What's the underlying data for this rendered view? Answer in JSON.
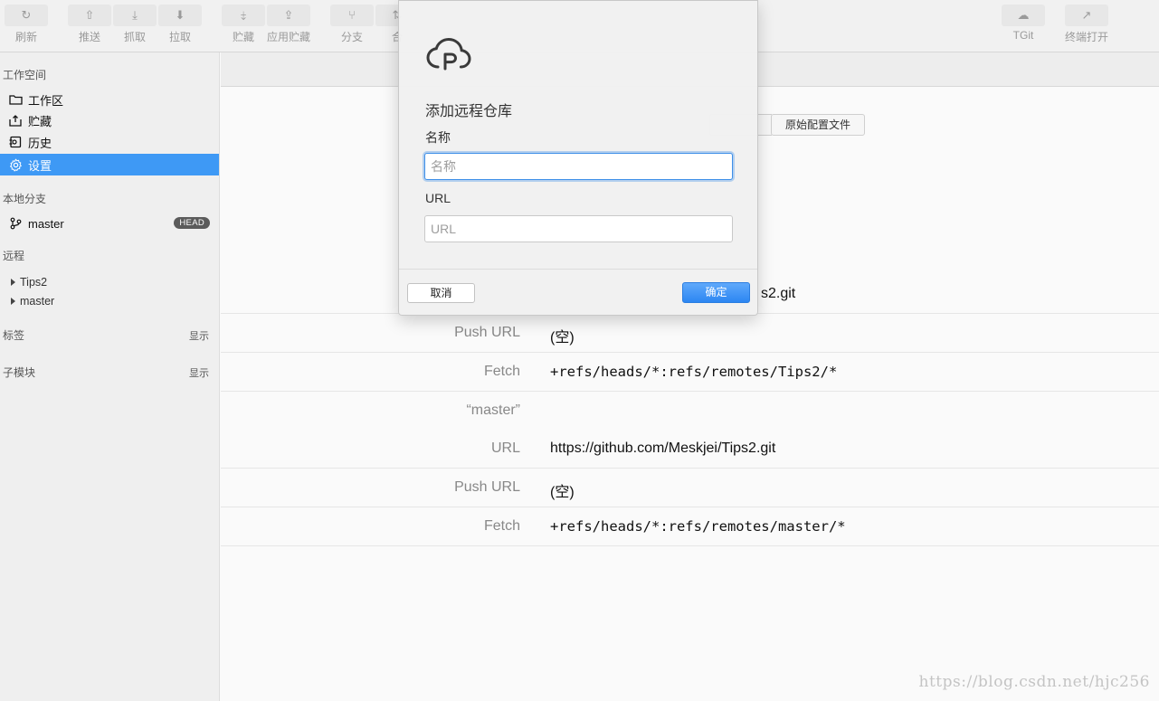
{
  "toolbar": {
    "buttons": [
      {
        "label": "刷新",
        "icon": "↻"
      },
      {
        "label": "推送",
        "icon": "⇧"
      },
      {
        "label": "抓取",
        "icon": "⤓"
      },
      {
        "label": "拉取",
        "icon": "⬇"
      },
      {
        "label": "贮藏",
        "icon": "⤈"
      },
      {
        "label": "应用贮藏",
        "icon": "⇪"
      },
      {
        "label": "分支",
        "icon": "⑂"
      },
      {
        "label": "合",
        "icon": "⇅"
      },
      {
        "label": "TGit",
        "icon": "☁"
      },
      {
        "label": "终端打开",
        "icon": "↗"
      }
    ]
  },
  "sidebar": {
    "workspace_title": "工作空间",
    "workspace_items": [
      {
        "label": "工作区",
        "icon": "folder-icon"
      },
      {
        "label": "贮藏",
        "icon": "stash-icon"
      },
      {
        "label": "历史",
        "icon": "history-icon"
      },
      {
        "label": "设置",
        "icon": "gear-icon",
        "active": true
      }
    ],
    "local_branch_title": "本地分支",
    "local_branch": {
      "label": "master",
      "badge": "HEAD"
    },
    "remote_title": "远程",
    "remotes": [
      "Tips2",
      "master"
    ],
    "tags_title": "标签",
    "tags_action": "显示",
    "submodules_title": "子模块",
    "submodules_action": "显示"
  },
  "content": {
    "config_button": "原始配置文件",
    "rows": [
      {
        "label": "",
        "value": "s2.git",
        "mono": false
      },
      {
        "label": "Push URL",
        "value": "(空)",
        "mono": false
      },
      {
        "label": "Fetch",
        "value": "+refs/heads/*:refs/remotes/Tips2/*",
        "mono": true
      },
      {
        "label": "“master”",
        "value": "",
        "mono": false
      },
      {
        "label": "URL",
        "value": "https://github.com/Meskjei/Tips2.git",
        "mono": false
      },
      {
        "label": "Push URL",
        "value": "(空)",
        "mono": false
      },
      {
        "label": "Fetch",
        "value": "+refs/heads/*:refs/remotes/master/*",
        "mono": true
      }
    ]
  },
  "dialog": {
    "title": "添加远程仓库",
    "name_label": "名称",
    "name_placeholder": "名称",
    "name_value": "",
    "url_label": "URL",
    "url_placeholder": "URL",
    "url_value": "",
    "cancel_label": "取消",
    "ok_label": "确定",
    "accent_color": "#3e99f5"
  },
  "watermark": "https://blog.csdn.net/hjc256"
}
